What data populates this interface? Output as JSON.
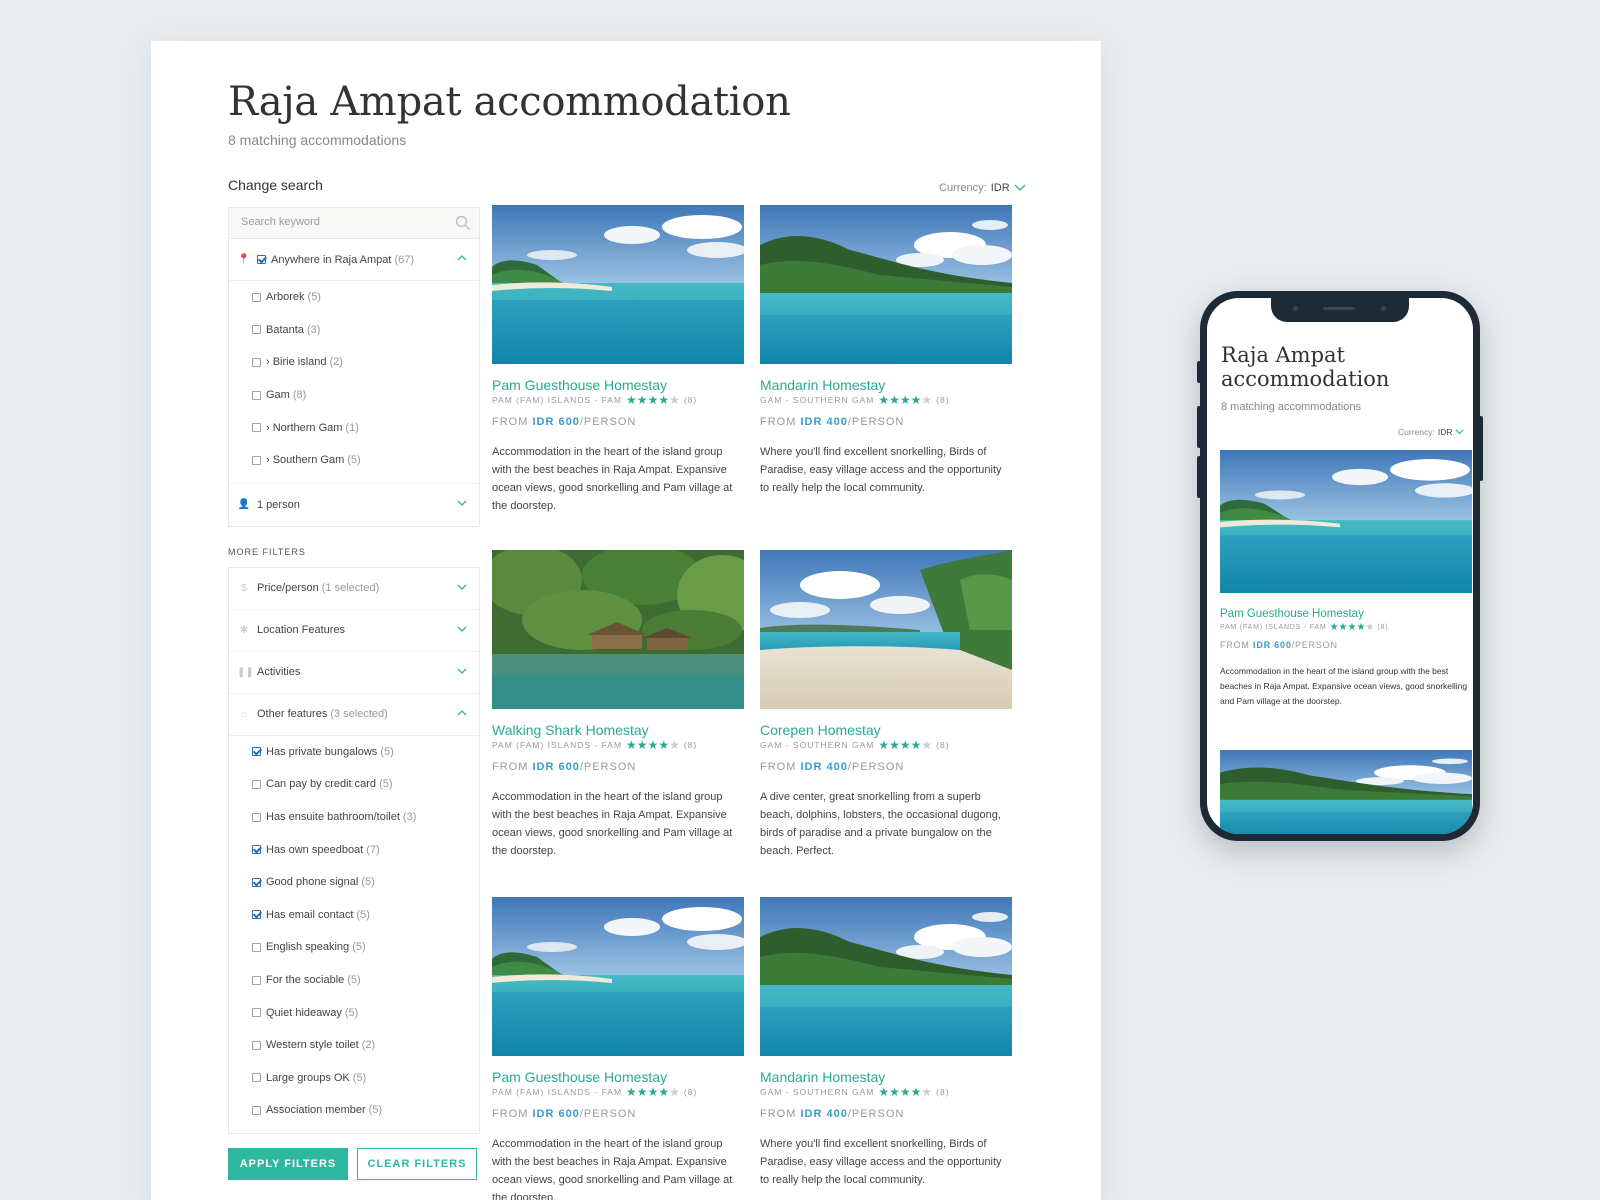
{
  "page": {
    "title": "Raja Ampat accommodation",
    "subtitle": "8 matching accommodations"
  },
  "sidebar": {
    "change_search": "Change search",
    "search_placeholder": "Search keyword",
    "location": {
      "label": "Anywhere in Raja Ampat",
      "count": "(67)",
      "checked": true
    },
    "locations": [
      {
        "label": "Arborek",
        "count": "(5)",
        "checked": false
      },
      {
        "label": "Batanta",
        "count": "(3)",
        "checked": false
      },
      {
        "label": "› Birie island",
        "count": "(2)",
        "checked": false
      },
      {
        "label": "Gam",
        "count": "(8)",
        "checked": false
      },
      {
        "label": "› Northern Gam",
        "count": "(1)",
        "checked": false
      },
      {
        "label": "› Southern Gam",
        "count": "(5)",
        "checked": false
      }
    ],
    "persons": "1 person",
    "more_filters": "MORE FILTERS",
    "filters": [
      {
        "label": "Price/person",
        "note": "(1 selected)"
      },
      {
        "label": "Location Features",
        "note": ""
      },
      {
        "label": "Activities",
        "note": ""
      }
    ],
    "other_features": {
      "label": "Other features",
      "note": "(3 selected)"
    },
    "features": [
      {
        "label": "Has private bungalows",
        "count": "(5)",
        "checked": true
      },
      {
        "label": "Can pay by credit card",
        "count": "(5)",
        "checked": false
      },
      {
        "label": "Has ensuite bathroom/toilet",
        "count": "(3)",
        "checked": false
      },
      {
        "label": "Has own speedboat",
        "count": "(7)",
        "checked": true
      },
      {
        "label": "Good phone signal",
        "count": "(5)",
        "checked": true
      },
      {
        "label": "Has email contact",
        "count": "(5)",
        "checked": true
      },
      {
        "label": "English speaking",
        "count": "(5)",
        "checked": false
      },
      {
        "label": "For the sociable",
        "count": "(5)",
        "checked": false
      },
      {
        "label": "Quiet hideaway",
        "count": "(5)",
        "checked": false
      },
      {
        "label": "Western style toilet",
        "count": "(2)",
        "checked": false
      },
      {
        "label": "Large groups OK",
        "count": "(5)",
        "checked": false
      },
      {
        "label": "Association member",
        "count": "(5)",
        "checked": false
      }
    ],
    "apply_label": "APPLY FILTERS",
    "clear_label": "CLEAR FILTERS"
  },
  "currency": {
    "label": "Currency:",
    "value": "IDR"
  },
  "listings": [
    {
      "name": "Pam Guesthouse Homestay",
      "location": "PAM (FAM) ISLANDS - FAM",
      "rating": 4,
      "reviews": "(8)",
      "from": "FROM",
      "price": "IDR 600",
      "unit": "/PERSON",
      "desc": "Accommodation in the heart of the island group with the best beaches in Raja Ampat. Expansive ocean views, good snorkelling and Pam village at the doorstep.",
      "photo": "island-beach"
    },
    {
      "name": "Mandarin Homestay",
      "location": "GAM - SOUTHERN GAM",
      "rating": 4,
      "reviews": "(8)",
      "from": "FROM",
      "price": "IDR 400",
      "unit": "/PERSON",
      "desc": "Where you'll find excellent snorkelling, Birds of Paradise, easy village access and the opportunity to really help the local community.",
      "photo": "bay-hills"
    },
    {
      "name": "Walking Shark Homestay",
      "location": "PAM (FAM) ISLANDS - FAM",
      "rating": 4,
      "reviews": "(8)",
      "from": "FROM",
      "price": "IDR 600",
      "unit": "/PERSON",
      "desc": "Accommodation in the heart of the island group with the best beaches in Raja Ampat. Expansive ocean views, good snorkelling and Pam village at the doorstep.",
      "photo": "jungle-huts"
    },
    {
      "name": "Corepen Homestay",
      "location": "GAM - SOUTHERN GAM",
      "rating": 4,
      "reviews": "(8)",
      "from": "FROM",
      "price": "IDR 400",
      "unit": "/PERSON",
      "desc": "A dive center, great snorkelling from a superb beach, dolphins, lobsters, the occasional dugong, birds of paradise and a private bungalow on the beach. Perfect.",
      "photo": "sandy-beach"
    },
    {
      "name": "Pam Guesthouse Homestay",
      "location": "PAM (FAM) ISLANDS - FAM",
      "rating": 4,
      "reviews": "(8)",
      "from": "FROM",
      "price": "IDR 600",
      "unit": "/PERSON",
      "desc": "Accommodation in the heart of the island group with the best beaches in Raja Ampat. Expansive ocean views, good snorkelling and Pam village at the doorstep.",
      "photo": "island-beach"
    },
    {
      "name": "Mandarin Homestay",
      "location": "GAM - SOUTHERN GAM",
      "rating": 4,
      "reviews": "(8)",
      "from": "FROM",
      "price": "IDR 400",
      "unit": "/PERSON",
      "desc": "Where you'll find excellent snorkelling, Birds of Paradise, easy village access and the opportunity to really help the local community.",
      "photo": "bay-hills"
    }
  ],
  "mobile": {
    "title": "Raja Ampat accommodation",
    "subtitle": "8 matching accommodations",
    "currency_label": "Currency:",
    "currency_value": "IDR",
    "listing": {
      "name": "Pam Guesthouse Homestay",
      "location": "PAM (FAM) ISLANDS - FAM",
      "rating": 4,
      "reviews": "(8)",
      "from": "FROM",
      "price": "IDR 600",
      "unit": "/PERSON",
      "desc": "Accommodation in the heart of the island group with the best beaches in Raja Ampat. Expansive ocean views, good snorkelling and Pam village at the doorstep."
    }
  },
  "colors": {
    "accent": "#2fb8a0",
    "price": "#3a9bc8",
    "checkbox": "#2a6fb6",
    "background": "#e9edf0",
    "phone": "#1e2a35"
  }
}
